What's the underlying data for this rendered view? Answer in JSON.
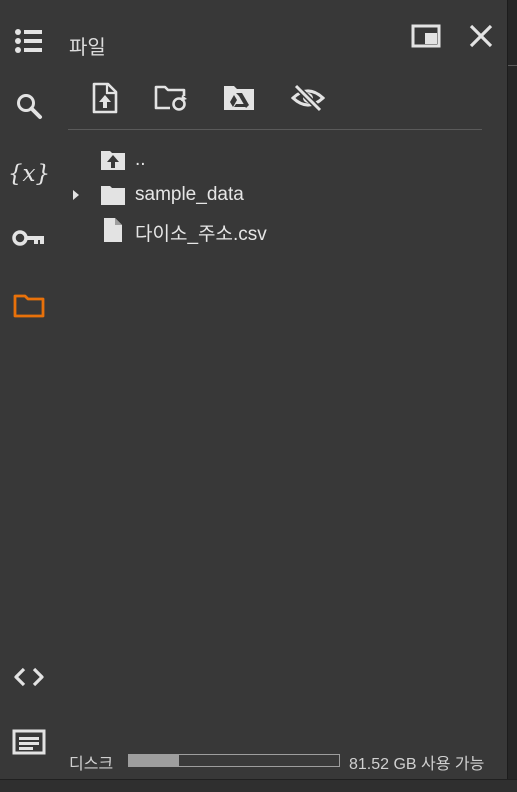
{
  "rail": {
    "items": [
      {
        "icon": "toc-icon",
        "active": false
      },
      {
        "icon": "search-icon",
        "active": false
      },
      {
        "icon": "variables-icon",
        "label": "{x}",
        "active": false
      },
      {
        "icon": "key-icon",
        "active": false
      },
      {
        "icon": "folder-icon",
        "active": true
      }
    ],
    "bottom_items": [
      {
        "icon": "code-icon"
      },
      {
        "icon": "terminal-icon"
      }
    ],
    "active_color": "#e8710a"
  },
  "files_panel": {
    "title": "파일",
    "header_buttons": [
      {
        "icon": "open-in-tab-icon"
      },
      {
        "icon": "close-icon"
      }
    ],
    "toolbar": [
      {
        "icon": "upload-file-icon"
      },
      {
        "icon": "refresh-folder-icon"
      },
      {
        "icon": "mount-drive-icon"
      },
      {
        "icon": "hide-hidden-files-icon"
      }
    ],
    "tree": [
      {
        "name": "..",
        "icon": "parent-folder-icon",
        "expandable": false
      },
      {
        "name": "sample_data",
        "icon": "folder-icon",
        "expandable": true
      },
      {
        "name": "다이소_주소.csv",
        "icon": "file-icon",
        "expandable": false
      }
    ]
  },
  "disk": {
    "label": "디스크",
    "used_fraction": 0.24,
    "free_text": "81.52 GB 사용 가능"
  }
}
